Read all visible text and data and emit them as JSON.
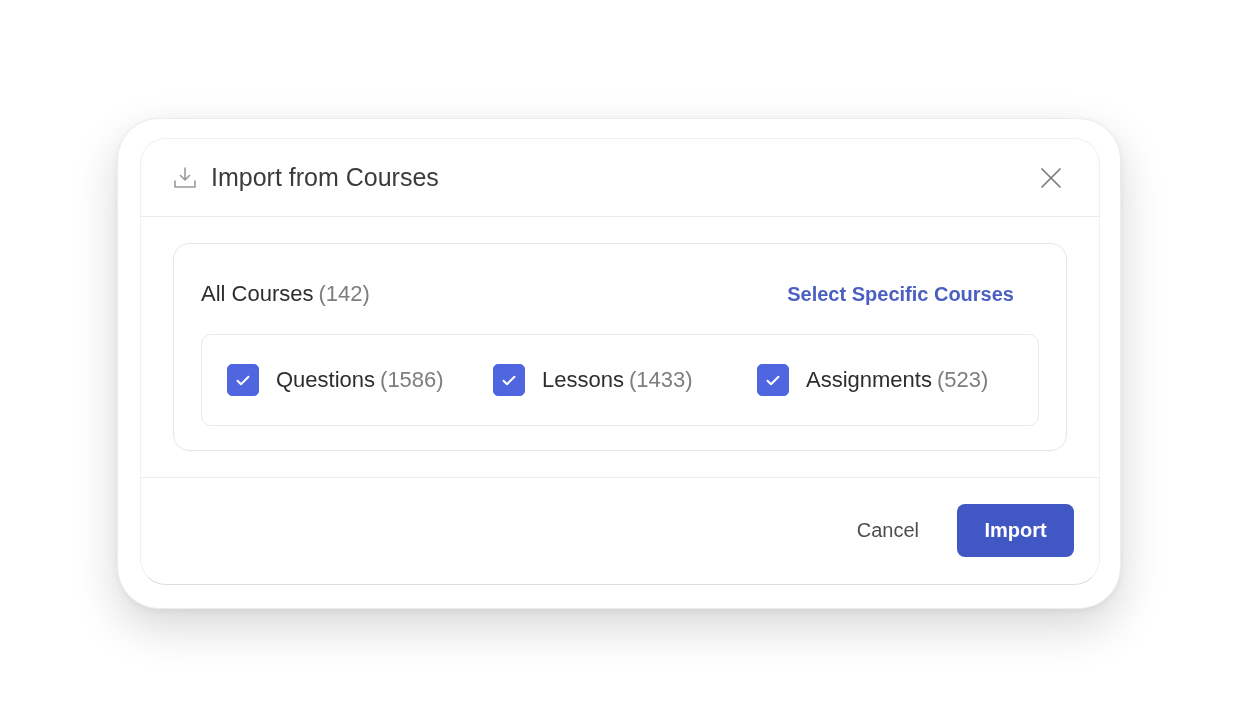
{
  "dialog": {
    "title": "Import from Courses"
  },
  "source": {
    "label": "All Courses",
    "count": "(142)",
    "link": "Select Specific Courses"
  },
  "content_types": [
    {
      "label": "Questions",
      "count": "(1586)",
      "checked": true
    },
    {
      "label": "Lessons",
      "count": "(1433)",
      "checked": true
    },
    {
      "label": "Assignments",
      "count": "(523)",
      "checked": true
    }
  ],
  "buttons": [
    {
      "label": "Cancel",
      "kind": "secondary"
    },
    {
      "label": "Import",
      "kind": "primary"
    }
  ]
}
